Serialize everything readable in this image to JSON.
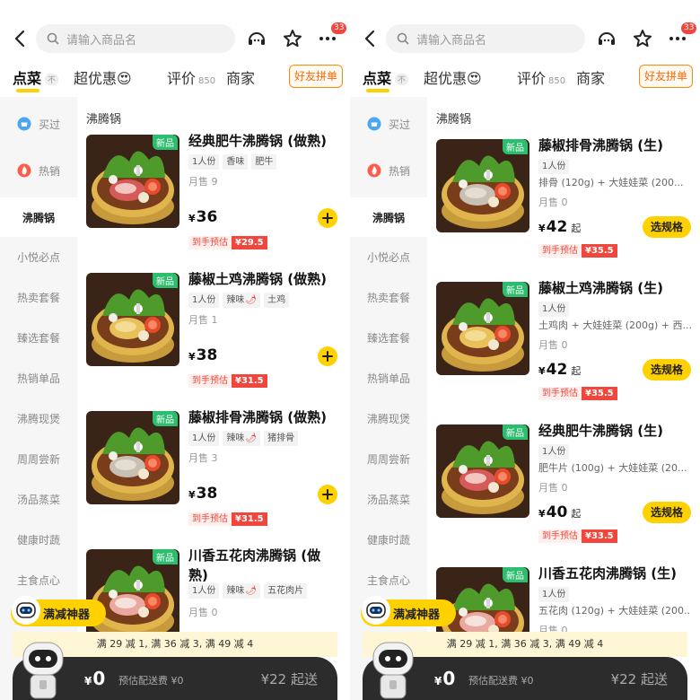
{
  "search": {
    "placeholder": "请输入商品名"
  },
  "header": {
    "badge": "33"
  },
  "tabs": [
    {
      "label": "点菜",
      "pill": "不"
    },
    {
      "label": "超优惠",
      "emoji": "😍"
    },
    {
      "label": "评价",
      "count": "850"
    },
    {
      "label": "商家"
    }
  ],
  "group_button": "好友拼单",
  "sidebar": [
    {
      "label": "买过",
      "icon": "bought-icon"
    },
    {
      "label": "热销",
      "icon": "fire-icon"
    },
    {
      "label": "沸腾锅"
    },
    {
      "label": "小悦必点"
    },
    {
      "label": "热卖套餐"
    },
    {
      "label": "臻选套餐"
    },
    {
      "label": "热销单品"
    },
    {
      "label": "沸腾现煲"
    },
    {
      "label": "周周尝新"
    },
    {
      "label": "汤品蒸菜"
    },
    {
      "label": "健康时蔬"
    },
    {
      "label": "主食点心"
    }
  ],
  "section_title": "沸腾锅",
  "left_products": [
    {
      "tag": "新品",
      "name": "经典肥牛沸腾锅 (做熟)",
      "tags": [
        "1人份",
        "香味",
        "肥牛"
      ],
      "sold": "月售 9",
      "price": "36",
      "est_label": "到手预估",
      "est_price": "¥29.5"
    },
    {
      "tag": "新品",
      "name": "藤椒土鸡沸腾锅 (做熟)",
      "tags": [
        "1人份",
        "辣味",
        "土鸡"
      ],
      "sold": "月售 1",
      "price": "38",
      "est_label": "到手预估",
      "est_price": "¥31.5"
    },
    {
      "tag": "新品",
      "name": "藤椒排骨沸腾锅 (做熟)",
      "tags": [
        "1人份",
        "辣味",
        "猪排骨"
      ],
      "sold": "月售 3",
      "price": "38",
      "est_label": "到手预估",
      "est_price": "¥31.5"
    },
    {
      "tag": "新品",
      "name": "川香五花肉沸腾锅 (做熟)",
      "tags": [
        "1人份",
        "辣味",
        "五花肉片"
      ],
      "sold": "月售 0"
    }
  ],
  "right_products": [
    {
      "tag": "新品",
      "name": "藤椒排骨沸腾锅 (生)",
      "tags": [
        "1人份"
      ],
      "desc": "排骨 (120g) + 大娃娃菜 (200...",
      "sold": "月售 0",
      "price": "42",
      "qi": "起",
      "spec": "选规格",
      "est_label": "到手预估",
      "est_price": "¥35.5"
    },
    {
      "tag": "新品",
      "name": "藤椒土鸡沸腾锅 (生)",
      "tags": [
        "1人份"
      ],
      "desc": "土鸡肉 + 大娃娃菜 (200g) + 西...",
      "sold": "月售 0",
      "price": "42",
      "qi": "起",
      "spec": "选规格",
      "est_label": "到手预估",
      "est_price": "¥35.5"
    },
    {
      "tag": "新品",
      "name": "经典肥牛沸腾锅 (生)",
      "tags": [
        "1人份"
      ],
      "desc": "肥牛片 (100g) + 大娃娃菜 (20...",
      "sold": "月售 0",
      "price": "40",
      "qi": "起",
      "spec": "选规格",
      "est_label": "到手预估",
      "est_price": "¥33.5"
    },
    {
      "tag": "新品",
      "name": "川香五花肉沸腾锅 (生)",
      "tags": [
        "1人份"
      ],
      "desc": "五花肉 (120g) + 大娃娃菜 (200...",
      "sold": "月售 0"
    }
  ],
  "manjian_button": "满减神器",
  "promo": "满 29 减 1, 满 36 减 3, 满 49 减 4",
  "cart": {
    "currency": "¥",
    "total": "0",
    "fee": "预估配送费 ¥0",
    "min_order": "¥22 起送"
  },
  "colors": {
    "accent": "#ffd100",
    "new_tag": "#2dbd6e",
    "estimate": "#f0463c",
    "cart_bg": "#2c2c2c"
  }
}
